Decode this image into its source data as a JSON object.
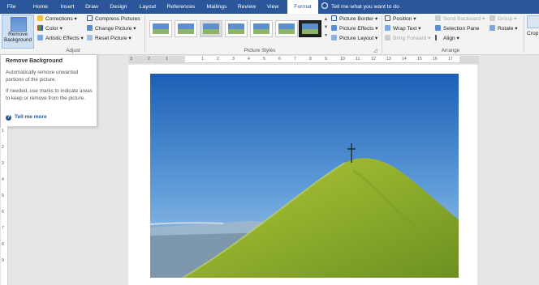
{
  "tabs": [
    {
      "label": "File"
    },
    {
      "label": "Home"
    },
    {
      "label": "Insert"
    },
    {
      "label": "Draw"
    },
    {
      "label": "Design"
    },
    {
      "label": "Layout"
    },
    {
      "label": "References"
    },
    {
      "label": "Mailings"
    },
    {
      "label": "Review"
    },
    {
      "label": "View"
    },
    {
      "label": "Format"
    }
  ],
  "tell_me": "Tell me what you want to do",
  "adjust": {
    "remove_bg_label": "Remove Background",
    "corrections": "Corrections",
    "color": "Color",
    "artistic_effects": "Artistic Effects",
    "compress": "Compress Pictures",
    "change": "Change Picture",
    "reset": "Reset Picture",
    "group_label": "Adjust"
  },
  "picture_styles": {
    "group_label": "Picture Styles"
  },
  "picture_opts": {
    "border": "Picture Border",
    "effects": "Picture Effects",
    "layout": "Picture Layout"
  },
  "arrange": {
    "position": "Position",
    "wrap_text": "Wrap Text",
    "bring_forward": "Bring Forward",
    "send_backward": "Send Backward",
    "selection_pane": "Selection Pane",
    "align": "Align",
    "group": "Group",
    "rotate": "Rotate",
    "group_label": "Arrange"
  },
  "crop": "Crop",
  "tooltip": {
    "title": "Remove Background",
    "p1": "Automatically remove unwanted portions of the picture.",
    "p2": "If needed, use marks to indicate areas to keep or remove from the picture.",
    "more": "Tell me more"
  },
  "ruler_numbers": [
    "3",
    "2",
    "1",
    "1",
    "2",
    "3",
    "4",
    "5",
    "6",
    "7",
    "8",
    "9",
    "10",
    "11",
    "12",
    "13",
    "14",
    "15",
    "16",
    "17"
  ],
  "vruler_numbers": [
    "1",
    "2",
    "3",
    "4",
    "5",
    "6",
    "7",
    "8",
    "9"
  ],
  "colors": {
    "accent": "#2b579a",
    "sky_top": "#1c5fb5",
    "grass": "#9ab52d"
  }
}
